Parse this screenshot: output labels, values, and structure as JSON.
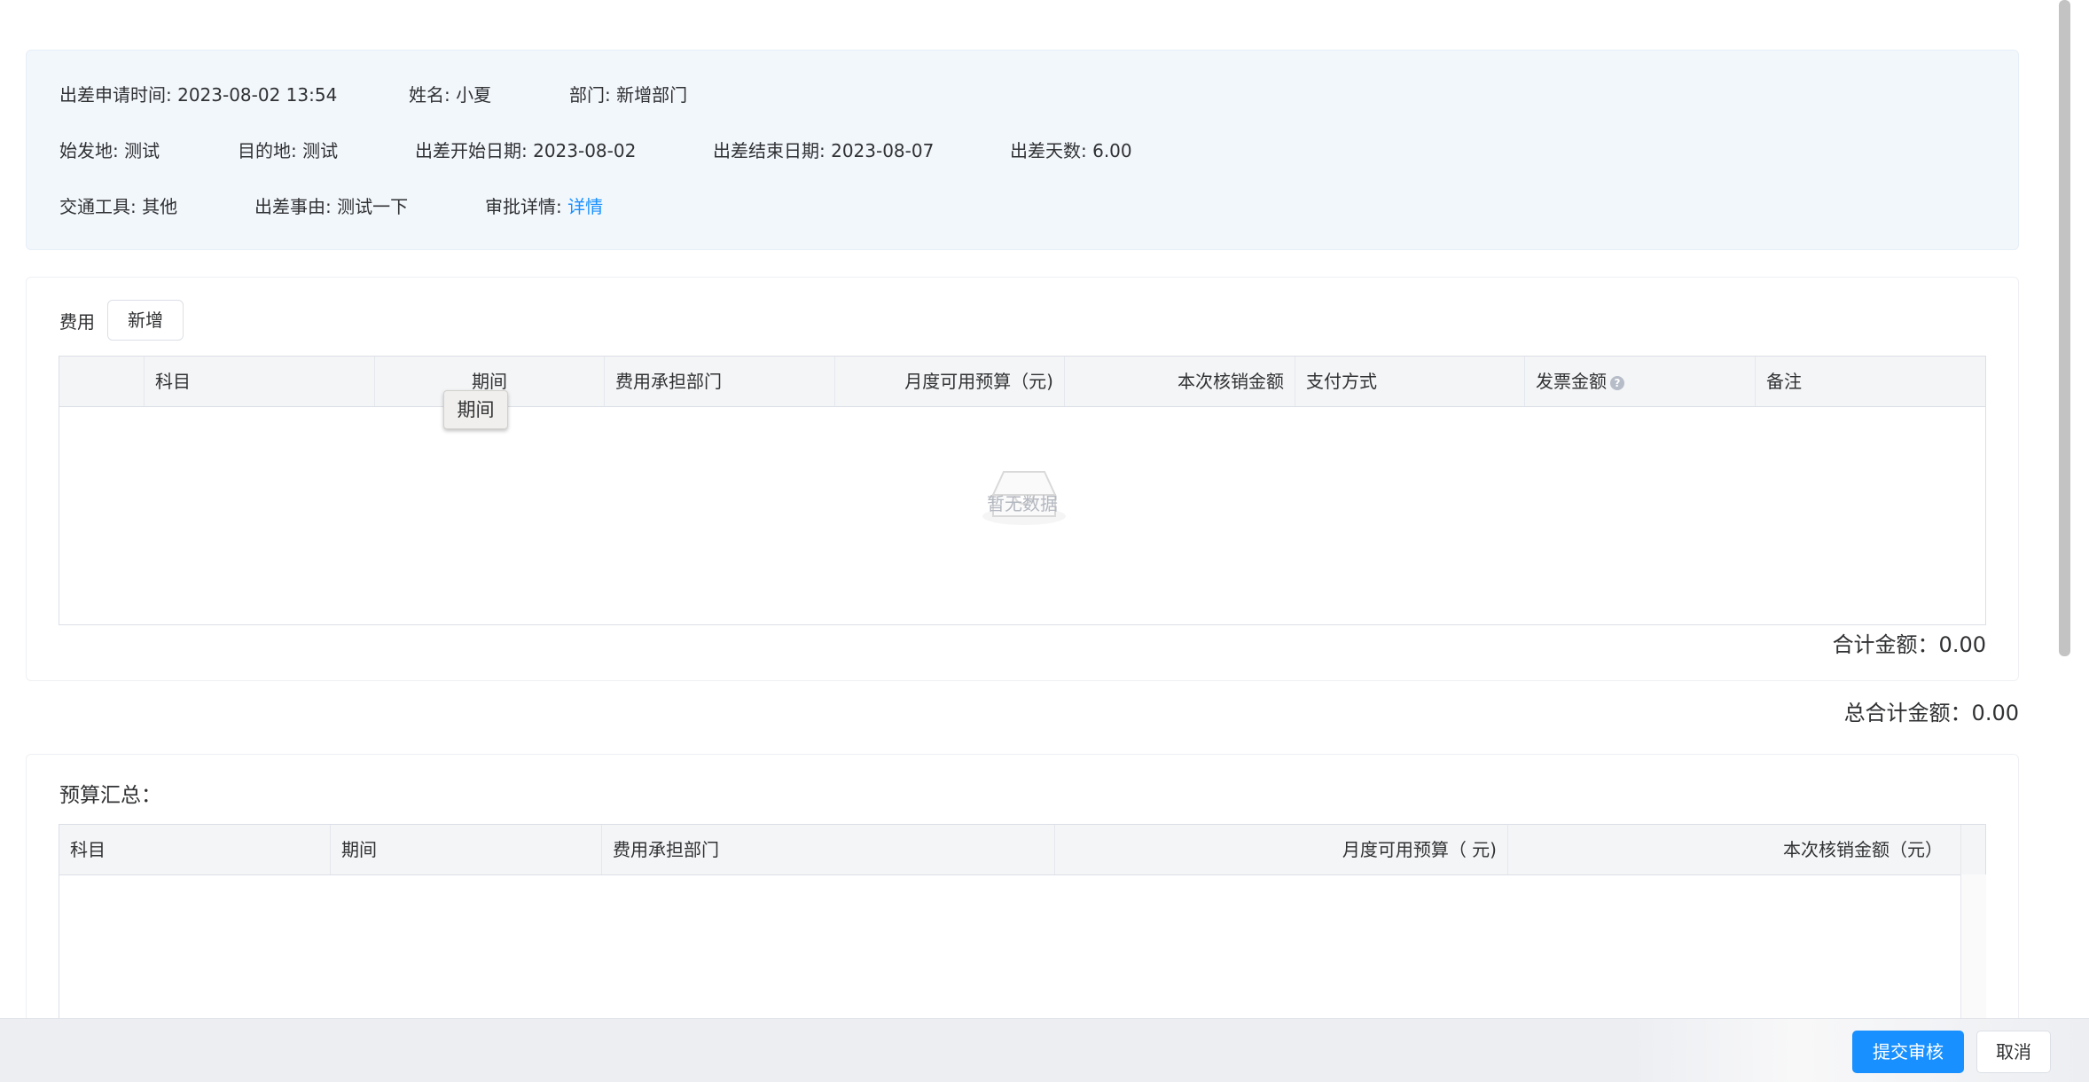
{
  "info": {
    "apply_time": "出差申请时间: 2023-08-02 13:54",
    "name": "姓名: 小夏",
    "department": "部门: 新增部门",
    "origin": "始发地: 测试",
    "destination": "目的地: 测试",
    "start_date": "出差开始日期: 2023-08-02",
    "end_date": "出差结束日期: 2023-08-07",
    "days": "出差天数: 6.00",
    "transport": "交通工具: 其他",
    "reason": "出差事由: 测试一下",
    "approval_label": "审批详情:",
    "approval_link": "详情"
  },
  "expense": {
    "label": "费用",
    "add_button": "新增",
    "columns": [
      "科目",
      "期间",
      "费用承担部门",
      "月度可用预算（元)",
      "本次核销金额",
      "支付方式",
      "发票金额",
      "备注"
    ],
    "help_icon": "?",
    "tooltip": "期间",
    "empty_text": "暂无数据",
    "subtotal": "合计金额：0.00"
  },
  "grand_total": "总合计金额：0.00",
  "budget": {
    "title": "预算汇总：",
    "columns": [
      "科目",
      "期间",
      "费用承担部门",
      "月度可用预算（ 元)",
      "本次核销金额（元）"
    ]
  },
  "footer": {
    "submit": "提交审核",
    "cancel": "取消"
  },
  "colors": {
    "primary": "#1890ff",
    "info_bg": "#f2f7fc",
    "header_bg": "#f4f5f7"
  }
}
